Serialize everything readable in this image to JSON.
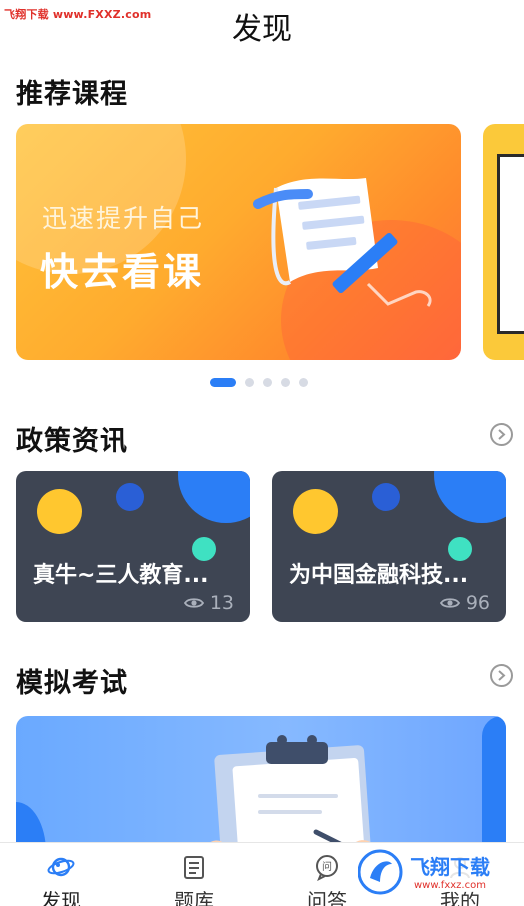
{
  "watermark_top": "飞翔下载 www.FXXZ.com",
  "header": {
    "title": "发现"
  },
  "recommended": {
    "title": "推荐课程",
    "banners": [
      {
        "subtitle": "迅速提升自己",
        "headline": "快去看课"
      }
    ],
    "carousel_page_count": 5,
    "carousel_active_index": 0
  },
  "policy_news": {
    "title": "政策资讯",
    "items": [
      {
        "title": "真牛~三人教育...",
        "views": "13"
      },
      {
        "title": "为中国金融科技...",
        "views": "96"
      }
    ]
  },
  "mock_exam": {
    "title": "模拟考试"
  },
  "tabbar": {
    "items": [
      {
        "label": "发现",
        "icon": "planet-icon",
        "active": true
      },
      {
        "label": "题库",
        "icon": "list-icon",
        "active": false
      },
      {
        "label": "问答",
        "icon": "question-bubble-icon",
        "active": false
      },
      {
        "label": "我的",
        "icon": "user-icon",
        "active": false
      }
    ]
  },
  "watermark_logo": {
    "brand": "飞翔下载",
    "url": "www.fxxz.com"
  },
  "colors": {
    "accent": "#2b7ef6",
    "banner_orange": "#ff8a2c",
    "card_bg": "#3e4553",
    "watermark_red": "#e0302a"
  }
}
